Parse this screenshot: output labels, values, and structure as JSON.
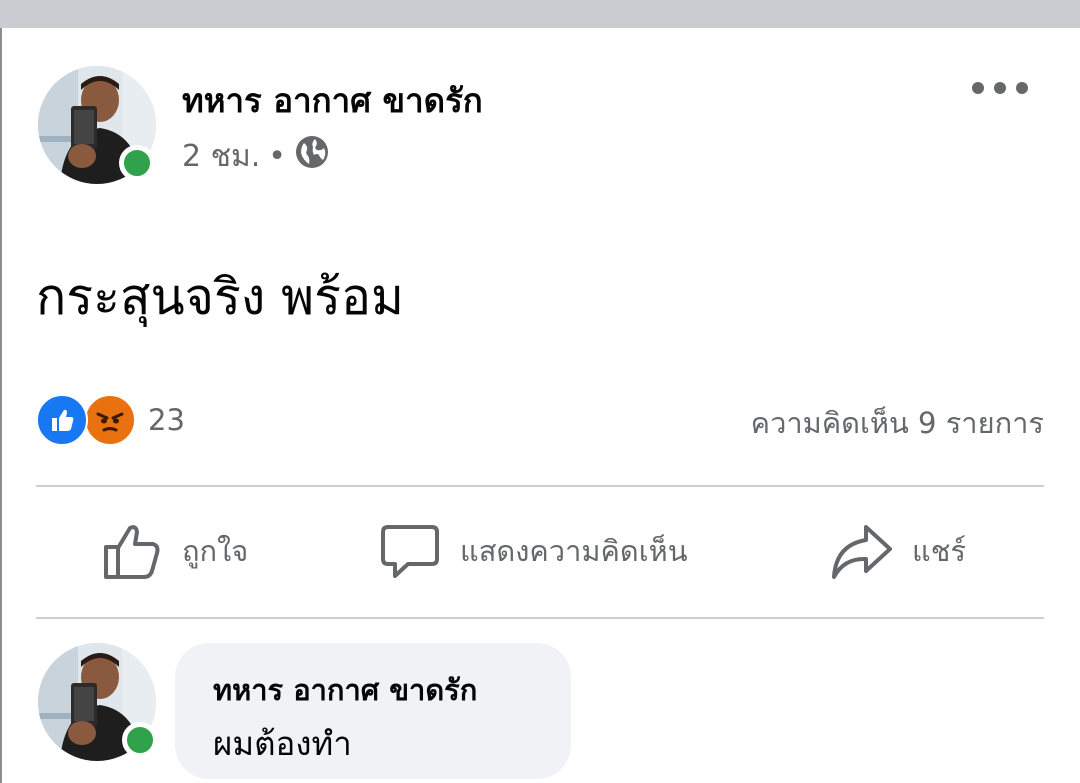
{
  "post": {
    "author": "ทหาร อากาศ ขาดรัก",
    "time": "2 ชม.",
    "separator": "•",
    "privacy_icon": "globe-icon",
    "text": "กระสุนจริง พร้อม"
  },
  "reactions": {
    "icons": [
      "like-icon",
      "angry-icon"
    ],
    "count": "23",
    "comment_count": "ความคิดเห็น 9 รายการ"
  },
  "actions": {
    "like_label": "ถูกใจ",
    "comment_label": "แสดงความคิดเห็น",
    "share_label": "แชร์"
  },
  "comment": {
    "author": "ทหาร อากาศ ขาดรัก",
    "text": "ผมต้องทำ"
  },
  "colors": {
    "online": "#31a24c",
    "like_blue": "#1877f2",
    "angry_orange": "#e9710f",
    "secondary_text": "#65676b",
    "bubble_bg": "#f0f2f5"
  }
}
